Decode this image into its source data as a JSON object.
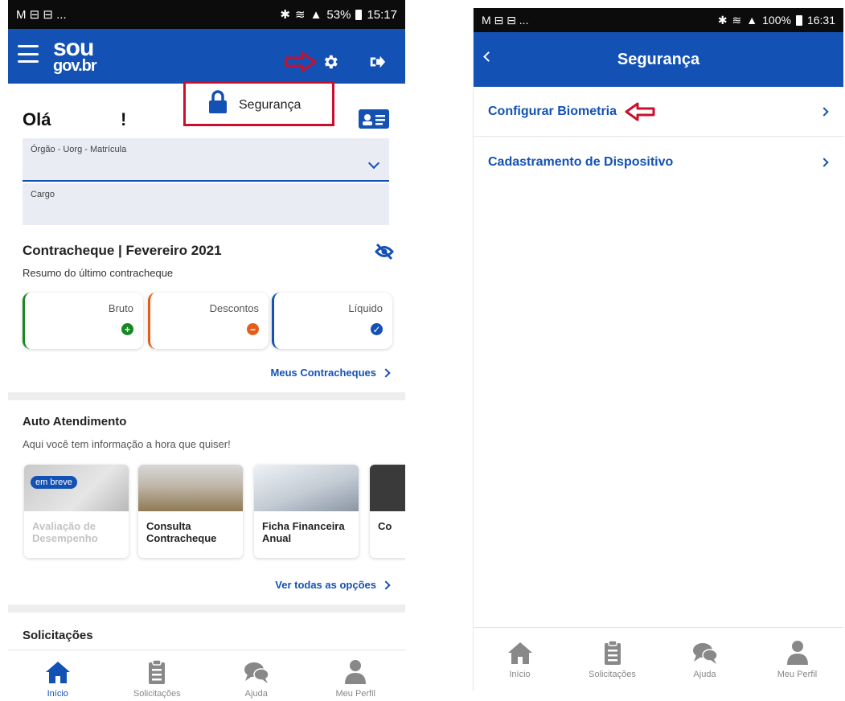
{
  "left": {
    "statusbar": {
      "left": "M ⊟ ⊟ ...",
      "battery": "53%",
      "time": "15:17"
    },
    "logo": {
      "line1": "sou",
      "line2": "gov.br"
    },
    "popup_label": "Segurança",
    "greeting": "Olá",
    "greeting_punct": "!",
    "field_orgao_label": "Órgão - Uorg - Matrícula",
    "field_cargo_label": "Cargo",
    "contracheque": {
      "title": "Contracheque | Fevereiro 2021",
      "subtitle": "Resumo do último contracheque",
      "cards": [
        {
          "label": "Bruto",
          "symbol": "+",
          "color": "#168821"
        },
        {
          "label": "Descontos",
          "symbol": "−",
          "color": "#e35d1a"
        },
        {
          "label": "Líquido",
          "symbol": "✓",
          "color": "#1351b4"
        }
      ],
      "link": "Meus Contracheques"
    },
    "auto": {
      "title": "Auto Atendimento",
      "subtitle": "Aqui você tem informação a hora que quiser!",
      "badge": "em breve",
      "items": [
        {
          "line1": "Avaliação de",
          "line2": "Desempenho"
        },
        {
          "line1": "Consulta",
          "line2": "Contracheque"
        },
        {
          "line1": "Ficha Financeira",
          "line2": "Anual"
        },
        {
          "line1": "Co",
          "line2": ""
        }
      ],
      "link": "Ver todas as opções"
    },
    "solicitacoes_title": "Solicitações",
    "nav": [
      "Início",
      "Solicitações",
      "Ajuda",
      "Meu Perfil"
    ]
  },
  "right": {
    "statusbar": {
      "left": "M ⊟ ⊟ ...",
      "battery": "100%",
      "time": "16:31"
    },
    "title": "Segurança",
    "items": [
      "Configurar Biometria",
      "Cadastramento de Dispositivo"
    ],
    "nav": [
      "Início",
      "Solicitações",
      "Ajuda",
      "Meu Perfil"
    ]
  },
  "colors": {
    "brand_blue": "#1351b4",
    "highlight_red": "#c8102e"
  }
}
